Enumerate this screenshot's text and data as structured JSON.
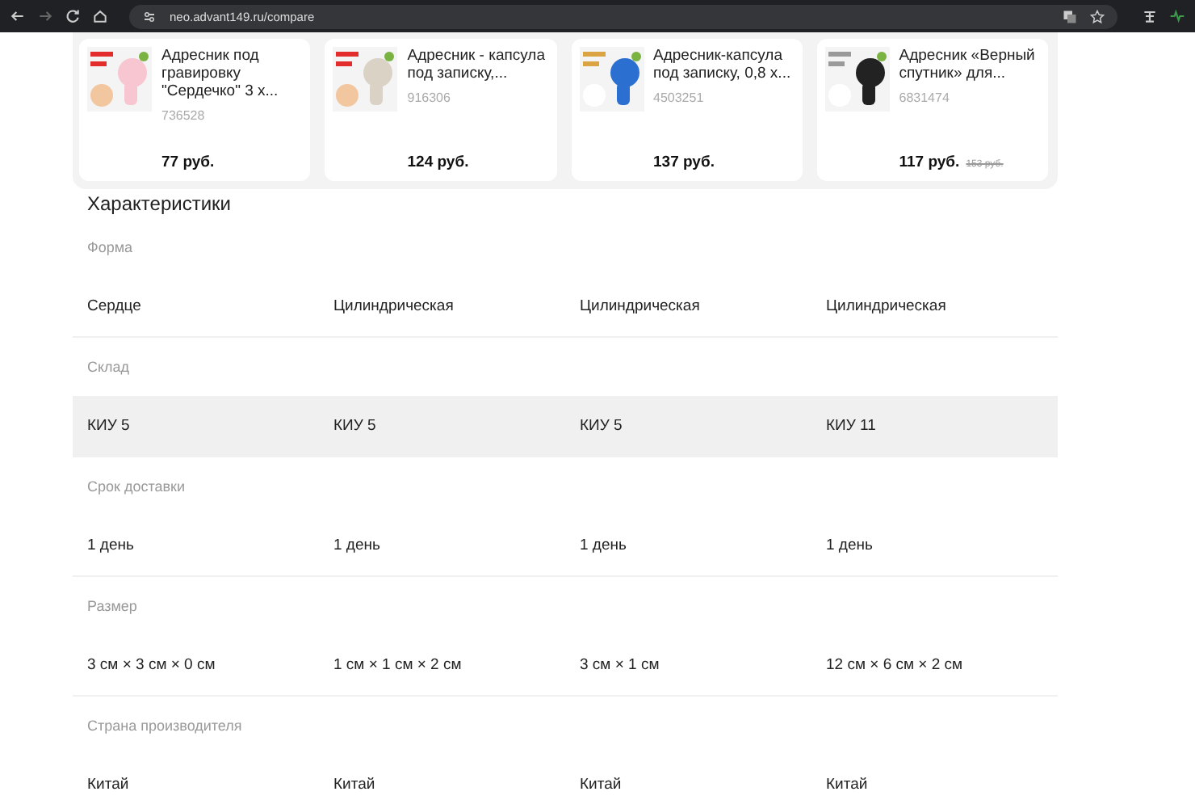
{
  "browser": {
    "url": "neo.advant149.ru/compare",
    "forward_disabled": true
  },
  "products": [
    {
      "name": "Адресник под гравировку \"Сердечко\" 3 х...",
      "sku": "736528",
      "price": "77 руб."
    },
    {
      "name": "Адресник - капсула под записку,...",
      "sku": "916306",
      "price": "124 руб."
    },
    {
      "name": "Адресник-капсула под записку, 0,8 х...",
      "sku": "4503251",
      "price": "137 руб."
    },
    {
      "name": "Адресник «Верный спутник» для...",
      "sku": "6831474",
      "price": "117 руб.",
      "old_price": "153 руб."
    }
  ],
  "section_title": "Характеристики",
  "characteristics": [
    {
      "label": "Форма",
      "values": [
        "Сердце",
        "Цилиндрическая",
        "Цилиндрическая",
        "Цилиндрическая"
      ],
      "highlighted": false
    },
    {
      "label": "Склад",
      "values": [
        "КИУ 5",
        "КИУ 5",
        "КИУ 5",
        "КИУ 11"
      ],
      "highlighted": true
    },
    {
      "label": "Срок доставки",
      "values": [
        "1 день",
        "1 день",
        "1 день",
        "1 день"
      ],
      "highlighted": false
    },
    {
      "label": "Размер",
      "values": [
        "3 см × 3 см × 0 см",
        "1 см × 1 см × 2 см",
        "3 см × 1 см",
        "12 см × 6 см × 2 см"
      ],
      "highlighted": false
    },
    {
      "label": "Страна производителя",
      "values": [
        "Китай",
        "Китай",
        "Китай",
        "Китай"
      ],
      "highlighted": false
    }
  ]
}
